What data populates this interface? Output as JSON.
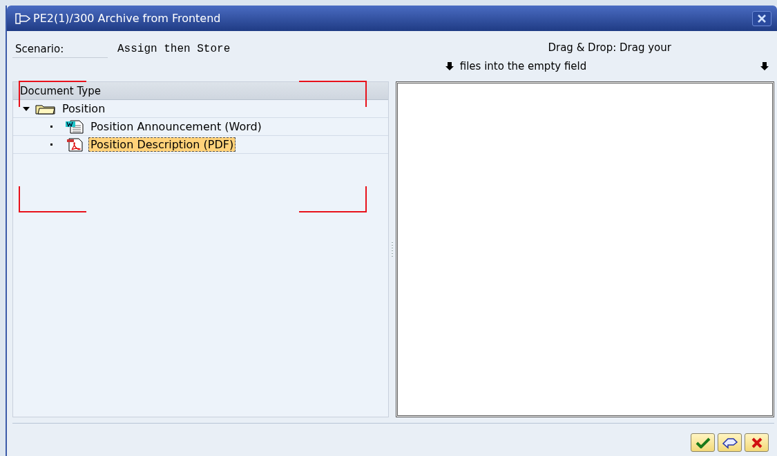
{
  "window": {
    "title": "PE2(1)/300 Archive from Frontend"
  },
  "scenario": {
    "label": "Scenario:",
    "value": "Assign then Store"
  },
  "drop_hint": {
    "line_1": "Drag & Drop: Drag your",
    "line_2": "files into the empty field"
  },
  "tree": {
    "header": "Document Type",
    "items": [
      {
        "label": "Position",
        "kind": "folder",
        "expanded": true,
        "selected": false,
        "children": [
          {
            "label": "Position Announcement (Word)",
            "kind": "word",
            "selected": false
          },
          {
            "label": "Position Description (PDF)",
            "kind": "pdf",
            "selected": true
          }
        ]
      }
    ]
  },
  "buttons": [
    {
      "kind": "confirm"
    },
    {
      "kind": "back"
    },
    {
      "kind": "cancel"
    }
  ]
}
